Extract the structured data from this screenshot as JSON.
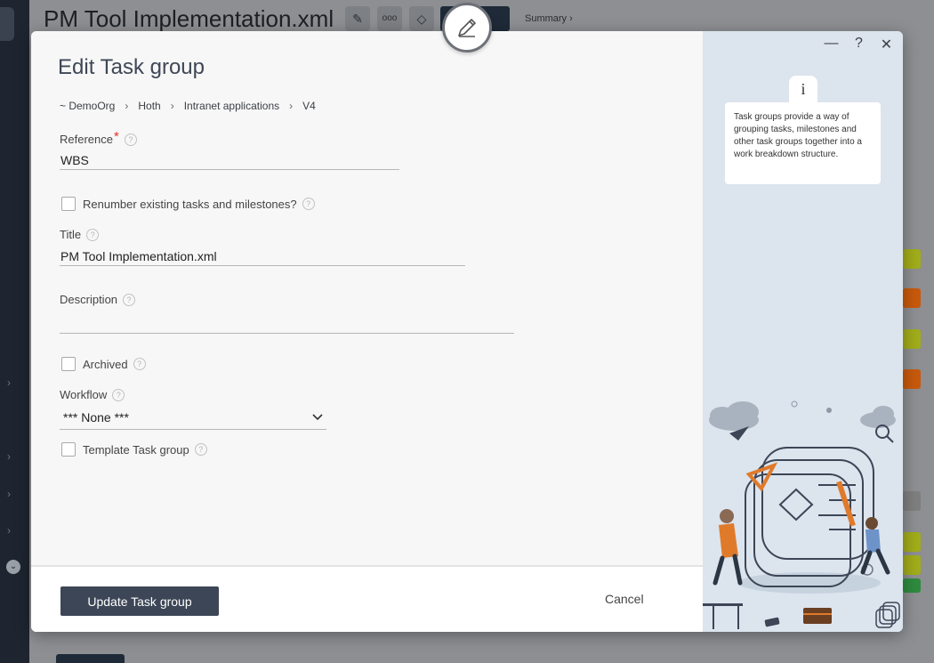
{
  "background": {
    "title": "PM Tool Implementation.xml",
    "summary_label": "Summary ›",
    "chip_colors": [
      "#a1ad1a",
      "#c8590d",
      "#a1ad1a",
      "#c8590d",
      "#7f7f7f",
      "#a1ad1a",
      "#a1ad1a",
      "#2e8b3f"
    ]
  },
  "modal": {
    "title": "Edit Task group",
    "breadcrumb": [
      "~ DemoOrg",
      "Hoth",
      "Intranet applications",
      "V4"
    ],
    "fields": {
      "reference_label": "Reference",
      "reference_value": "WBS",
      "renumber_label": "Renumber existing tasks and milestones?",
      "title_label": "Title",
      "title_value": "PM Tool Implementation.xml",
      "description_label": "Description",
      "description_value": "",
      "archived_label": "Archived",
      "workflow_label": "Workflow",
      "workflow_value": "*** None ***",
      "template_label": "Template Task group"
    },
    "buttons": {
      "update": "Update Task group",
      "cancel": "Cancel"
    },
    "window_controls": {
      "minimize": "—",
      "help": "?",
      "close": "✕"
    },
    "info": {
      "tab_glyph": "i",
      "text": "Task groups provide a way of grouping tasks, milestones and other task groups together into a work breakdown structure."
    }
  },
  "colors": {
    "primary_button": "#3c4656",
    "required_marker": "#e0322b",
    "side_panel": "#dce4ee"
  }
}
